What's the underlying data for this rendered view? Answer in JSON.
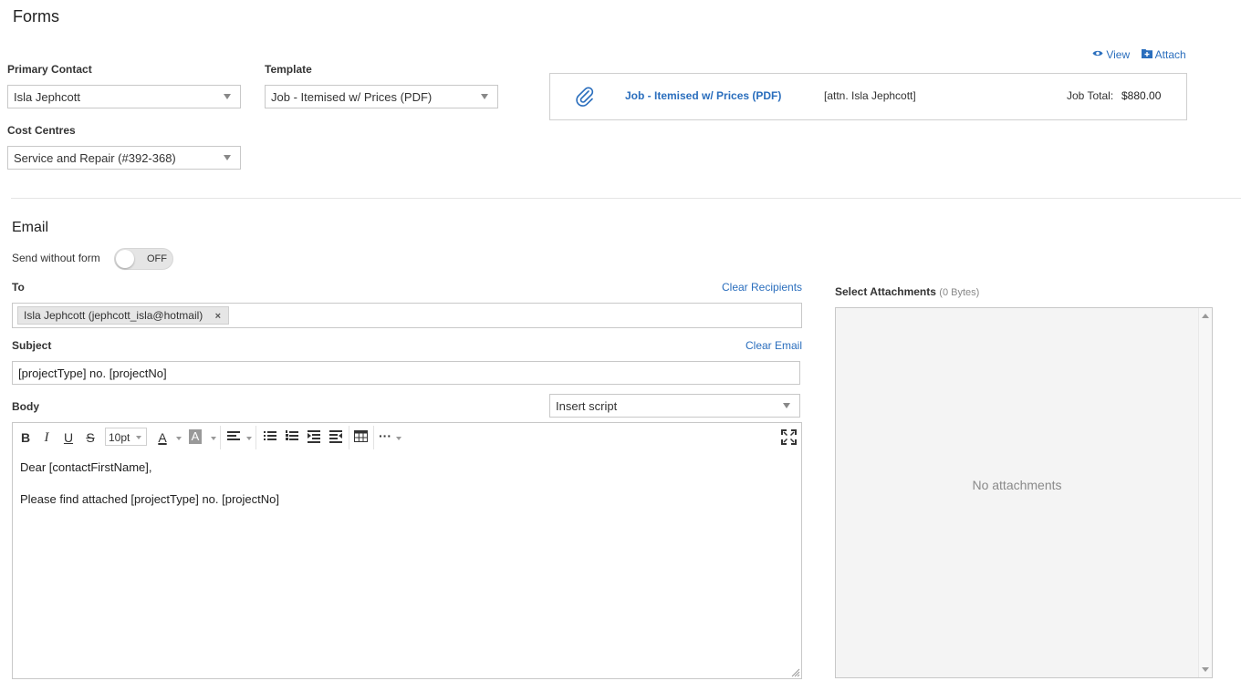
{
  "page": {
    "title": "Forms"
  },
  "form": {
    "primary_contact": {
      "label": "Primary Contact",
      "value": "Isla Jephcott"
    },
    "template": {
      "label": "Template",
      "value": "Job - Itemised w/ Prices (PDF)"
    },
    "cost_centres": {
      "label": "Cost Centres",
      "value": "Service and Repair (#392-368)"
    }
  },
  "attachment_preview": {
    "view_label": "View",
    "attach_label": "Attach",
    "file_name": "Job - Itemised w/ Prices (PDF)",
    "attention": "[attn. Isla Jephcott]",
    "total_label": "Job Total:",
    "total_value": "$880.00"
  },
  "email": {
    "heading": "Email",
    "send_without_form_label": "Send without form",
    "toggle_state": "OFF",
    "to_label": "To",
    "clear_recipients": "Clear Recipients",
    "recipient_chip": "Isla Jephcott (jephcott_isla@hotmail)",
    "remove_symbol": "×",
    "subject_label": "Subject",
    "clear_email": "Clear Email",
    "subject_value": "[projectType] no. [projectNo]",
    "body_label": "Body",
    "insert_script": "Insert script",
    "font_size": "10pt",
    "body_lines": [
      "Dear [contactFirstName],",
      "Please find attached [projectType] no. [projectNo]"
    ]
  },
  "toolbar": {
    "bold": "B",
    "italic": "I",
    "underline": "U",
    "strike": "S",
    "text_color": "A",
    "highlight": "A",
    "more": "···"
  },
  "attachments": {
    "label": "Select Attachments",
    "size": "(0 Bytes)",
    "empty_text": "No attachments"
  },
  "colors": {
    "accent": "#2a6ebd",
    "border": "#c8c8c8"
  },
  "icons": [
    "eye-icon",
    "folder-plus-icon",
    "paperclip-icon",
    "align-left-icon",
    "bullet-list-icon",
    "numbered-list-icon",
    "indent-icon",
    "outdent-icon",
    "table-icon",
    "fullscreen-icon"
  ]
}
